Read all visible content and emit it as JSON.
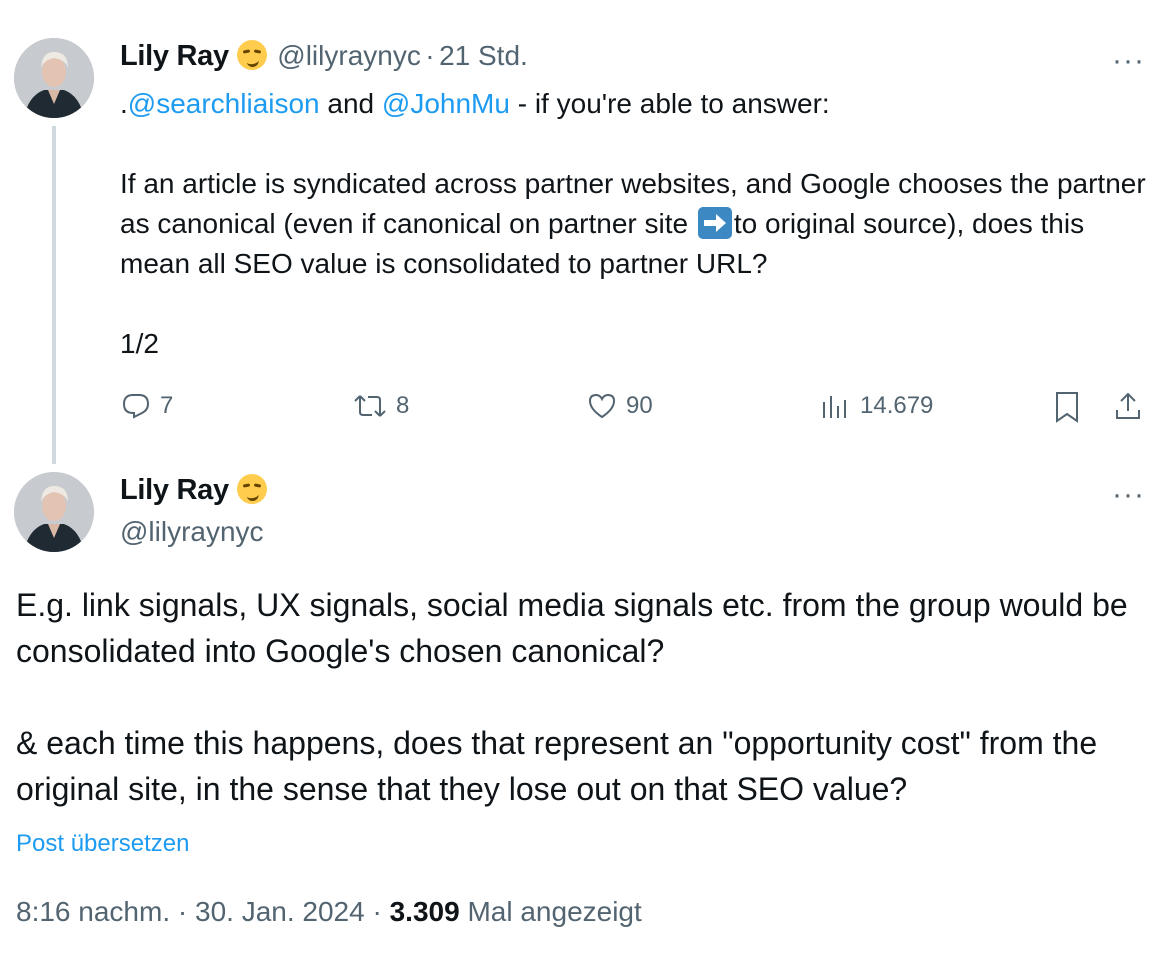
{
  "tweet1": {
    "author_name": "Lily Ray",
    "author_emoji": "smirking-face",
    "handle": "@lilyraynyc",
    "separator": "·",
    "time_ago": "21 Std.",
    "mention_prefix": ".",
    "mention1": "@searchliaison",
    "and": " and ",
    "mention2": "@JohnMu",
    "line1_rest": " - if you're able to answer:",
    "para2_part1": "If an article is syndicated across partner websites, and Google chooses the partner as canonical (even if canonical on partner site ",
    "para2_emoji": "right-arrow",
    "para2_part2": "to original source), does this mean all SEO value is consolidated to partner URL?",
    "para3": "1/2",
    "actions": {
      "replies": "7",
      "retweets": "8",
      "likes": "90",
      "views": "14.679"
    },
    "more_label": "···"
  },
  "tweet2": {
    "author_name": "Lily Ray",
    "handle": "@lilyraynyc",
    "more_label": "···",
    "para1": "E.g. link signals, UX signals, social media signals etc. from the group would be consolidated into Google's chosen canonical?",
    "para2": "& each time this happens, does that represent an \"opportunity cost\" from the original site, in the sense that they lose out on that SEO value?",
    "translate_link": "Post übersetzen",
    "meta_time": "8:16 nachm.",
    "meta_sep1": " · ",
    "meta_date": "30. Jan. 2024",
    "meta_sep2": " · ",
    "meta_views_count": "3.309",
    "meta_views_label": " Mal angezeigt"
  },
  "colors": {
    "link": "#1d9bf0",
    "secondary_text": "#536471",
    "thread_line": "#cfd9de"
  }
}
